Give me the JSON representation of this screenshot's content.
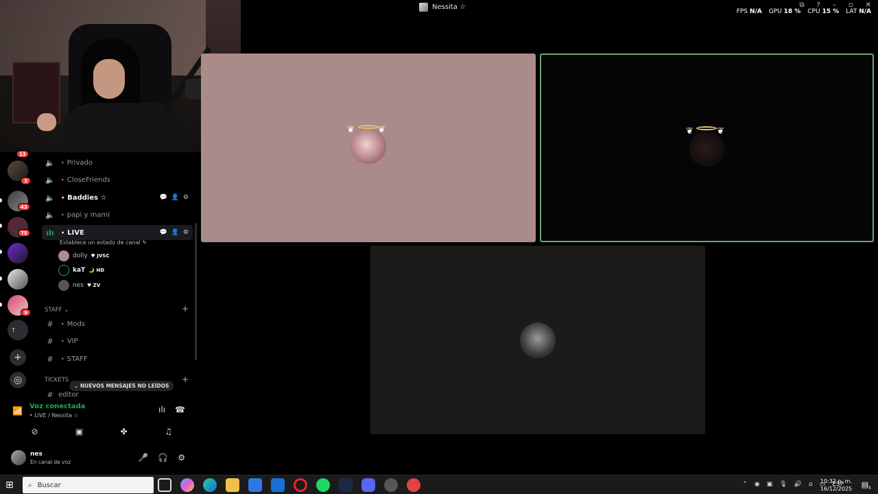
{
  "window": {
    "title": "Nessita ☆",
    "stats": {
      "fps_label": "FPS",
      "fps_value": "N/A",
      "gpu_label": "GPU",
      "gpu_value": "18 %",
      "cpu_label": "CPU",
      "cpu_value": "15 %",
      "lat_label": "LAT",
      "lat_value": "N/A"
    }
  },
  "servers": {
    "badges": [
      "13",
      "3",
      "43",
      "75",
      "9"
    ],
    "folder_letter": "T"
  },
  "channels": [
    {
      "label": "Privado",
      "icon": "speaker-icon"
    },
    {
      "label": "CloseFriends",
      "icon": "speaker-icon"
    },
    {
      "label": "Baddies ☆",
      "icon": "speaker-icon"
    },
    {
      "label": "papi y mami",
      "icon": "speaker-icon"
    },
    {
      "label": "LIVE",
      "icon": "live-voice-icon"
    }
  ],
  "live_status": "Establece un estado de canal",
  "voice_users": [
    {
      "name": "dolly",
      "tag": "JVSC"
    },
    {
      "name": "kaT",
      "tag": "HD"
    },
    {
      "name": "nes",
      "tag": "ZV"
    }
  ],
  "categories": {
    "staff": "STAFF",
    "tickets": "TICKETS"
  },
  "text_channels": [
    "Mods",
    "VIP",
    "STAFF",
    "editor"
  ],
  "unread_pill": "NUEVOS MENSAJES NO LEÍDOS",
  "voice_panel": {
    "status": "Voz conectada",
    "location": "LIVE / Nessita ☆"
  },
  "user": {
    "name": "nes",
    "status": "En canal de voz"
  },
  "taskbar": {
    "search_placeholder": "Buscar",
    "lang": "ESP",
    "time": "10:32 p. m.",
    "date": "16/12/2025",
    "notif_count": "5"
  },
  "colors": {
    "accent_green": "#23a55a",
    "badge_red": "#f23f43",
    "tile_border": "#6aa876"
  }
}
